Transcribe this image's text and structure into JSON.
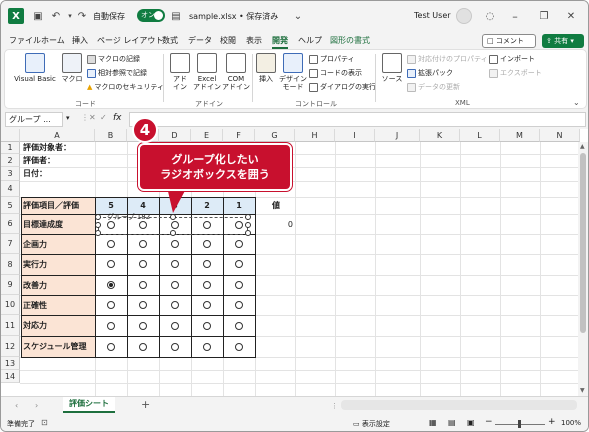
{
  "title_bar": {
    "autosave_label": "自動保存",
    "autosave_state": "オン",
    "document_title": "sample.xlsx • 保存済み",
    "user_name": "Test User",
    "app_logo": "X"
  },
  "menu": {
    "tabs": [
      "ファイル",
      "ホーム",
      "挿入",
      "ページ レイアウト",
      "数式",
      "データ",
      "校閲",
      "表示",
      "開発",
      "ヘルプ",
      "図形の書式"
    ],
    "active_tab": "開発",
    "comment_label": "コメント",
    "share_label": "共有"
  },
  "ribbon": {
    "vba": "Visual Basic",
    "macro": "マクロ",
    "record_macro": "マクロの記録",
    "relative_ref": "相対参照で記録",
    "macro_security": "マクロのセキュリティ",
    "code_group": "コード",
    "addins": "アド\nイン",
    "excel_addins": "Excel\nアドイン",
    "com_addins": "COM\nアドイン",
    "addin_group": "アドイン",
    "insert": "挿入",
    "design_mode": "デザイン\nモード",
    "properties": "プロパティ",
    "view_code": "コードの表示",
    "run_dialog": "ダイアログの実行",
    "controls_group": "コントロール",
    "source": "ソース",
    "map_properties": "対応付けのプロパティ",
    "expansion_packs": "拡張パック",
    "refresh_data": "データの更新",
    "import": "インポート",
    "export": "エクスポート",
    "xml_group": "XML"
  },
  "formula_bar": {
    "name_box": "グループ ...",
    "fx": "fx",
    "formula": ""
  },
  "columns": [
    "A",
    "B",
    "C",
    "D",
    "E",
    "F",
    "G",
    "H",
    "I",
    "J",
    "K",
    "L",
    "M",
    "N"
  ],
  "rows": [
    "1",
    "2",
    "3",
    "4",
    "5",
    "6",
    "7",
    "8",
    "9",
    "10",
    "11",
    "12",
    "13",
    "14"
  ],
  "sheet": {
    "evaluatee": "評価対象者：",
    "evaluator": "評価者：",
    "date": "日付：",
    "header": "評価項目／評価",
    "scores": [
      "5",
      "4",
      "3",
      "2",
      "1"
    ],
    "value_header": "値",
    "value_row6": "0",
    "group_label": "グループ 182",
    "items": [
      "目標達成度",
      "企画力",
      "実行力",
      "改善力",
      "正確性",
      "対応力",
      "スケジュール管理"
    ]
  },
  "selected_radio": {
    "item": "改善力",
    "score": "5"
  },
  "callout": {
    "step_number": "4",
    "text_line1": "グループ化したい",
    "text_line2": "ラジオボックスを囲う"
  },
  "sheet_tabs": {
    "active": "評価シート",
    "add": "+"
  },
  "status_bar": {
    "ready": "準備完了",
    "display_settings": "表示設定",
    "zoom": "100%"
  },
  "colors": {
    "accent": "#107c41",
    "callout": "#c8102e",
    "pink_fill": "#fbe4d5",
    "blue_fill": "#ddebf7"
  }
}
